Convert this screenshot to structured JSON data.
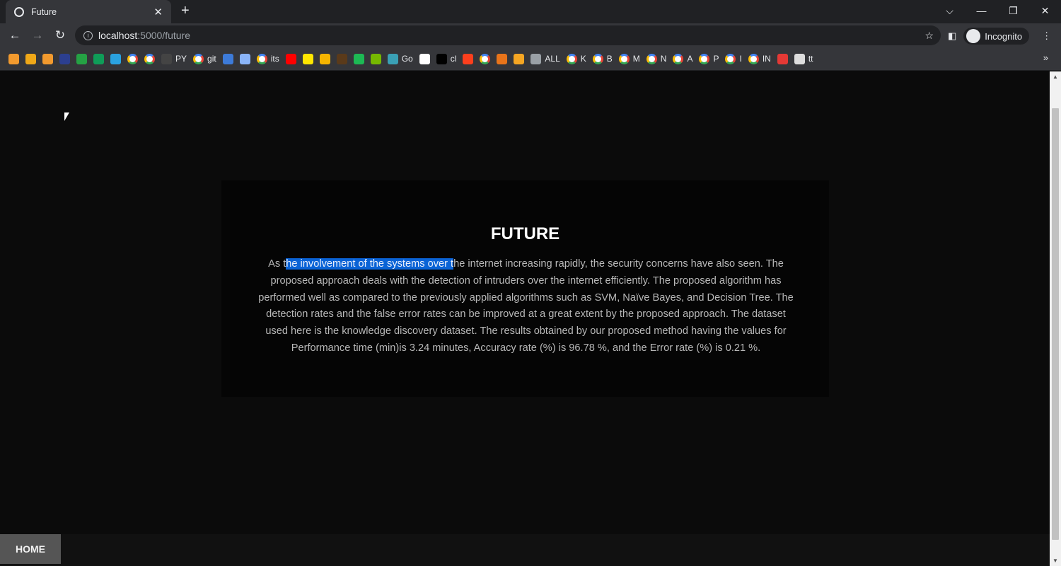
{
  "browser": {
    "tab_title": "Future",
    "url_host": "localhost",
    "url_path": ":5000/future",
    "profile": "Incognito"
  },
  "bookmarks": [
    {
      "label": "",
      "color": "#f29a2e"
    },
    {
      "label": "",
      "color": "#f0a818"
    },
    {
      "label": "",
      "color": "#f29a2e"
    },
    {
      "label": "",
      "color": "#2c3f8f"
    },
    {
      "label": "",
      "color": "#25a244"
    },
    {
      "label": "",
      "color": "#0f9d58"
    },
    {
      "label": "",
      "color": "#2aa2e0"
    },
    {
      "label": "",
      "g": true
    },
    {
      "label": "",
      "g": true
    },
    {
      "label": "PY",
      "color": "#444"
    },
    {
      "label": "git",
      "g": true
    },
    {
      "label": "",
      "color": "#3d7bd9"
    },
    {
      "label": "",
      "color": "#8ab4f8"
    },
    {
      "label": "its",
      "g": true
    },
    {
      "label": "",
      "color": "#ff0000"
    },
    {
      "label": "",
      "color": "#ffe600"
    },
    {
      "label": "",
      "color": "#f5b400"
    },
    {
      "label": "",
      "color": "#5a3a1a"
    },
    {
      "label": "",
      "color": "#1db954"
    },
    {
      "label": "",
      "color": "#76b900"
    },
    {
      "label": "Go",
      "color": "#3aa0b5"
    },
    {
      "label": "",
      "color": "#ffffff"
    },
    {
      "label": "cl",
      "color": "#000000"
    },
    {
      "label": "",
      "color": "#fc3f1d"
    },
    {
      "label": "",
      "g": true
    },
    {
      "label": "",
      "color": "#e8741a"
    },
    {
      "label": "",
      "color": "#f5a623"
    },
    {
      "label": "ALL",
      "color": "#9aa0a6"
    },
    {
      "label": "K",
      "g": true
    },
    {
      "label": "B",
      "g": true
    },
    {
      "label": "M",
      "g": true
    },
    {
      "label": "N",
      "g": true
    },
    {
      "label": "A",
      "g": true
    },
    {
      "label": "P",
      "g": true
    },
    {
      "label": "I",
      "g": true
    },
    {
      "label": "IN",
      "g": true
    },
    {
      "label": "",
      "color": "#e53935"
    },
    {
      "label": "tt",
      "color": "#ddd"
    }
  ],
  "page": {
    "title": "FUTURE",
    "para_before": "As t",
    "para_selected": "he involvement of the systems over t",
    "para_after": "he internet increasing rapidly, the security concerns have also seen. The proposed approach deals with the detection of intruders over the internet efficiently. The proposed algorithm has performed well as compared to the previously applied algorithms such as SVM, Naïve Bayes, and Decision Tree. The detection rates and the false error rates can be improved at a great extent by the proposed approach. The dataset used here is the knowledge discovery dataset. The results obtained by our proposed method having the values for Performance time (min)is 3.24 minutes, Accuracy rate (%) is 96.78 %, and the Error rate (%) is 0.21 %."
  },
  "footer": {
    "home_label": "HOME"
  }
}
